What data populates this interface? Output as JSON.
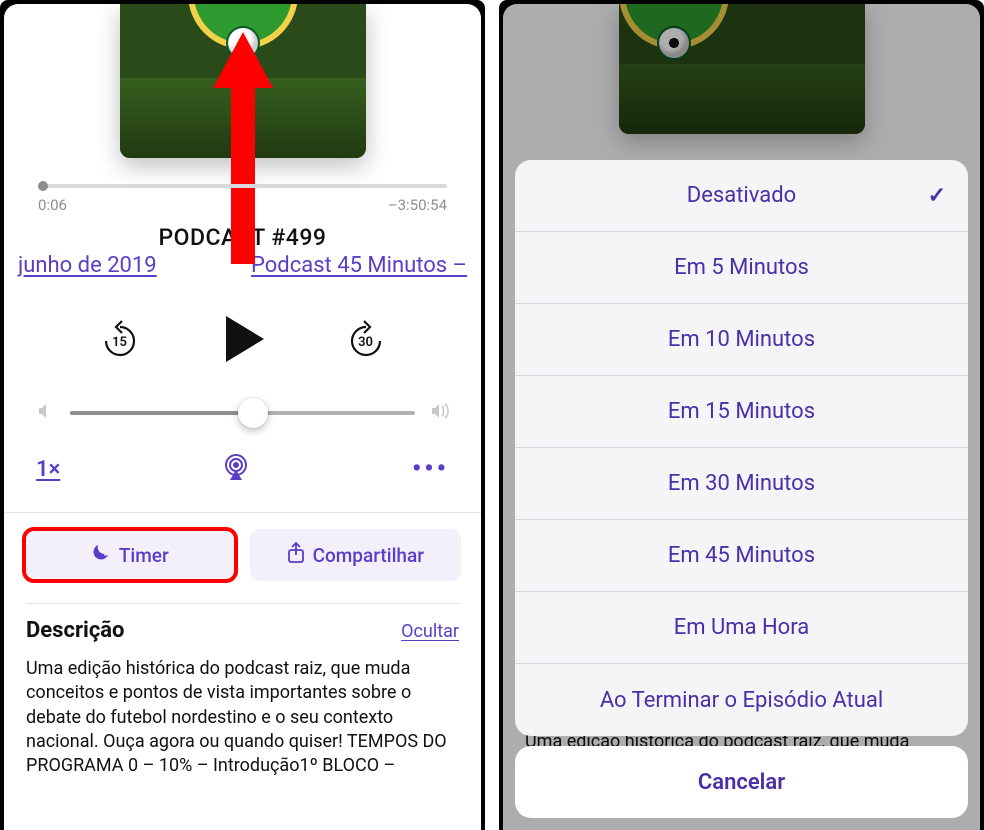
{
  "player": {
    "time_elapsed": "0:06",
    "time_remaining": "–3:50:54",
    "title": "PODCAST #499",
    "subtitle_left": " junho de 2019",
    "subtitle_right": "Podcast 45 Minutos – ",
    "skip_back_seconds": "15",
    "skip_fwd_seconds": "30",
    "speed_label": "1×",
    "more_label": "•••"
  },
  "actions": {
    "timer_label": "Timer",
    "share_label": "Compartilhar"
  },
  "description": {
    "heading": "Descrição",
    "hide_label": "Ocultar",
    "body": "Uma edição histórica do podcast raiz, que muda conceitos e pontos de vista importantes sobre o debate do futebol nordestino e o seu contexto nacional. Ouça agora ou quando quiser! TEMPOS DO PROGRAMA 0 – 10% – Introdução1º BLOCO –"
  },
  "bg_desc_right": "Uma edição histórica do podcast raiz, que muda",
  "timer_sheet": {
    "options": [
      "Desativado",
      "Em 5 Minutos",
      "Em 10 Minutos",
      "Em 15 Minutos",
      "Em 30 Minutos",
      "Em 45 Minutos",
      "Em Uma Hora",
      "Ao Terminar o Episódio Atual"
    ],
    "selected_index": 0,
    "cancel_label": "Cancelar"
  }
}
